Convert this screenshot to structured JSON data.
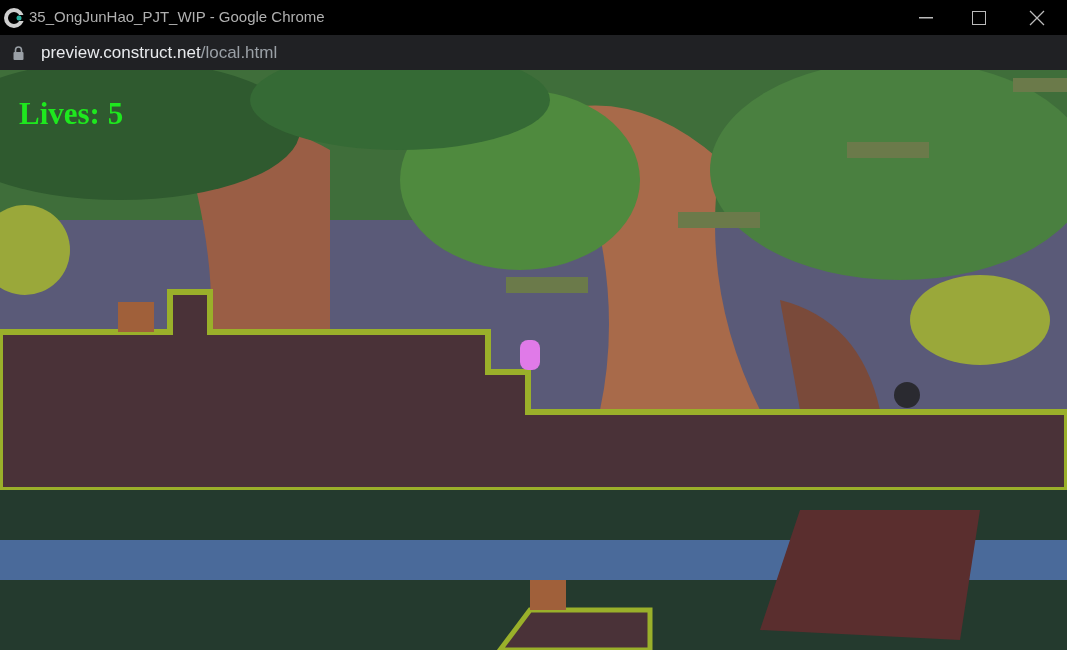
{
  "window": {
    "title": "35_OngJunHao_PJT_WIP - Google Chrome"
  },
  "address_bar": {
    "host": "preview.construct.net",
    "path": "/local.html"
  },
  "game": {
    "hud": {
      "lives": "Lives: 5"
    }
  }
}
